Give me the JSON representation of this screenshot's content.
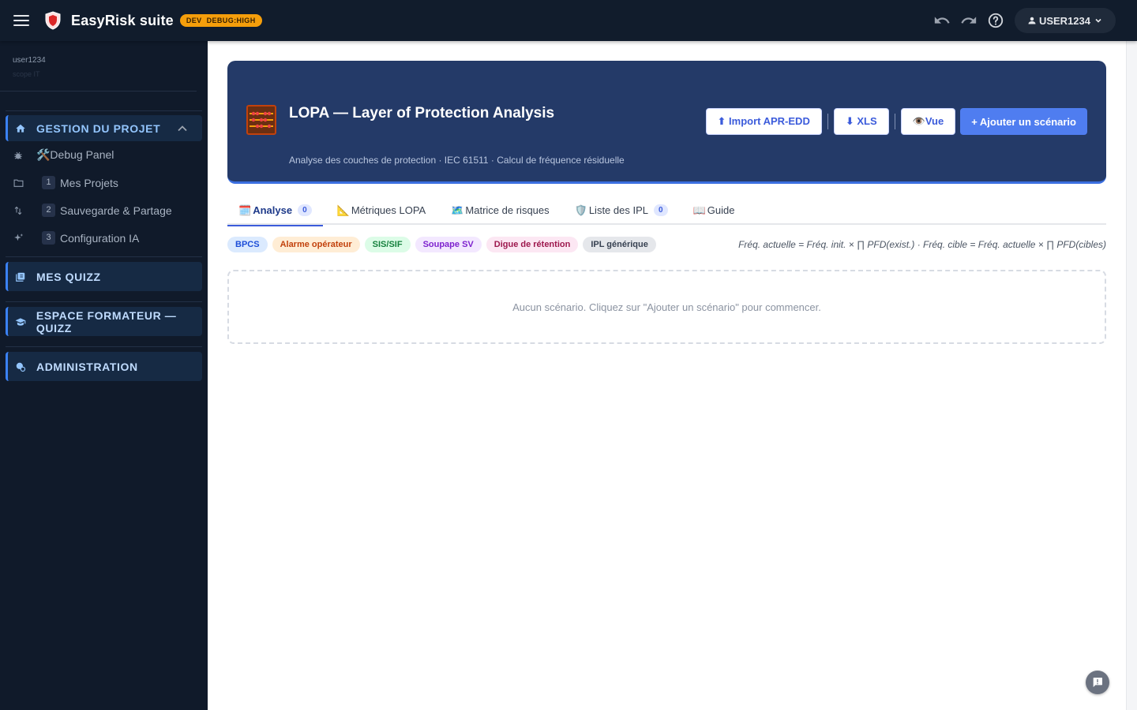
{
  "topbar": {
    "title": "EasyRisk suite",
    "env_badge": {
      "env": "DEV",
      "debug": "DEBUG:HIGH"
    },
    "user_label": "USER1234",
    "icons": [
      "menu-icon",
      "shield-logo-icon",
      "undo-icon",
      "redo-icon",
      "help-icon",
      "person-icon",
      "chevron-down-icon"
    ]
  },
  "sidebar": {
    "username": "user1234",
    "user_sub": "scope IT",
    "sections": {
      "project": {
        "label": "GESTION DU PROJET",
        "items": [
          {
            "num": "",
            "label": "🛠️Debug Panel",
            "icon": "bug-icon"
          },
          {
            "num": "1",
            "label": "Mes Projets",
            "icon": "folder-icon"
          },
          {
            "num": "2",
            "label": "Sauvegarde & Partage",
            "icon": "swap-icon"
          },
          {
            "num": "3",
            "label": "Configuration IA",
            "icon": "sparkle-icon"
          }
        ]
      },
      "quizz": {
        "label": "MES QUIZZ",
        "icon": "quiz-icon"
      },
      "trainer": {
        "label": "ESPACE FORMATEUR — QUIZZ",
        "icon": "graduation-icon"
      },
      "admin": {
        "label": "ADMINISTRATION",
        "icon": "admin-icon"
      }
    }
  },
  "hero": {
    "title": "LOPA — Layer of Protection Analysis",
    "subtitle": "Analyse des couches de protection · IEC 61511 · Calcul de fréquence résiduelle",
    "buttons": {
      "import": "⬆ Import APR-EDD",
      "xls": "⬇ XLS",
      "view": "👁️Vue",
      "add": "+ Ajouter un scénario"
    }
  },
  "tabs": [
    {
      "emoji": "🗓️",
      "label": "Analyse",
      "count": "0"
    },
    {
      "emoji": "📐",
      "label": "Métriques LOPA",
      "count": ""
    },
    {
      "emoji": "🗺️",
      "label": "Matrice de risques",
      "count": ""
    },
    {
      "emoji": "🛡️",
      "label": "Liste des IPL",
      "count": "0"
    },
    {
      "emoji": "📖",
      "label": "Guide",
      "count": ""
    }
  ],
  "chips": [
    {
      "label": "BPCS",
      "bg": "#dbeafe",
      "fg": "#1d4ed8"
    },
    {
      "label": "Alarme opérateur",
      "bg": "#ffedd5",
      "fg": "#c2410c"
    },
    {
      "label": "SIS/SIF",
      "bg": "#dcfce7",
      "fg": "#15803d"
    },
    {
      "label": "Soupape SV",
      "bg": "#f3e8ff",
      "fg": "#7e22ce"
    },
    {
      "label": "Digue de rétention",
      "bg": "#fce7f3",
      "fg": "#9d174d"
    },
    {
      "label": "IPL générique",
      "bg": "#e5e7eb",
      "fg": "#374151"
    }
  ],
  "formula": "Fréq. actuelle = Fréq. init. × ∏ PFD(exist.) · Fréq. cible = Fréq. actuelle × ∏ PFD(cibles)",
  "empty_message": "Aucun scénario. Cliquez sur \"Ajouter un scénario\" pour commencer.",
  "colors": {
    "topbar": "#111c2c",
    "sidebar": "#101a2a",
    "hero": "#243a68",
    "accent": "#4f7df0",
    "env_badge": "#f59e0b"
  }
}
